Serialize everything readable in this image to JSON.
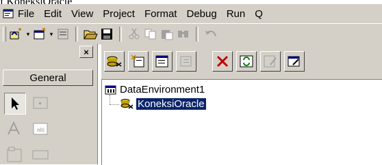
{
  "caption": "f KoneksiOracle",
  "menu": {
    "items": [
      "File",
      "Edit",
      "View",
      "Project",
      "Format",
      "Debug",
      "Run",
      "Q"
    ]
  },
  "toolbox": {
    "close_label": "×",
    "general_label": "General"
  },
  "tree": {
    "root_label": "DataEnvironment1",
    "child_label": "KoneksiOracle"
  },
  "colors": {
    "face": "#d4d0c8",
    "selection": "#0a246a"
  }
}
